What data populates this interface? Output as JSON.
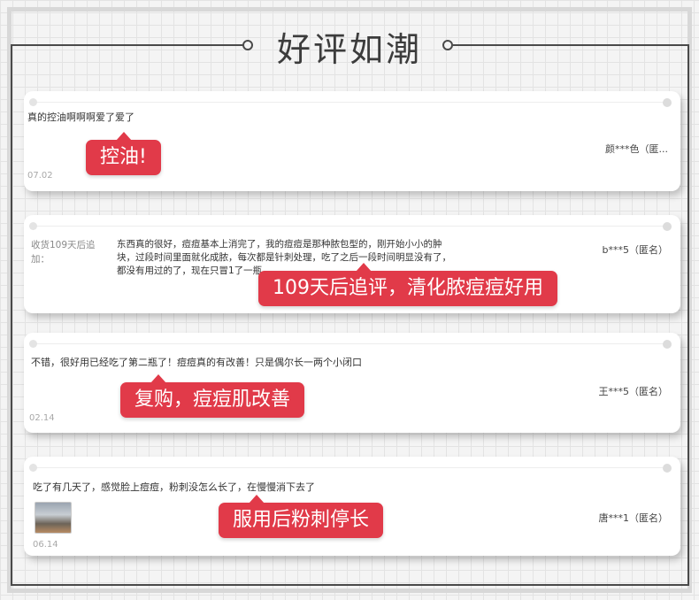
{
  "page": {
    "title": "好评如潮"
  },
  "reviews": [
    {
      "text": "真的控油啊啊啊爱了爱了",
      "date": "07.02",
      "reviewer": "颜***色（匿...",
      "badge": "控油!"
    },
    {
      "followup_label": "收货109天后追加：",
      "text": "东西真的很好，痘痘基本上消完了，我的痘痘是那种脓包型的，刚开始小小的肿块，过段时间里面就化成脓，每次都是针刺处理，吃了之后一段时间明显没有了，都没有用过的了，现在只冒1了一瓶",
      "reviewer": "b***5（匿名）",
      "badge": "109天后追评，清化脓痘痘好用"
    },
    {
      "text": "不错，很好用已经吃了第二瓶了！痘痘真的有改善！只是偶尔长一两个小闭口",
      "date": "02.14",
      "reviewer": "王***5（匿名）",
      "badge": "复购，痘痘肌改善"
    },
    {
      "text": "吃了有几天了，感觉脸上痘痘，粉刺没怎么长了，在慢慢消下去了",
      "date": "06.14",
      "reviewer": "唐***1（匿名）",
      "badge": "服用后粉刺停长"
    }
  ]
}
